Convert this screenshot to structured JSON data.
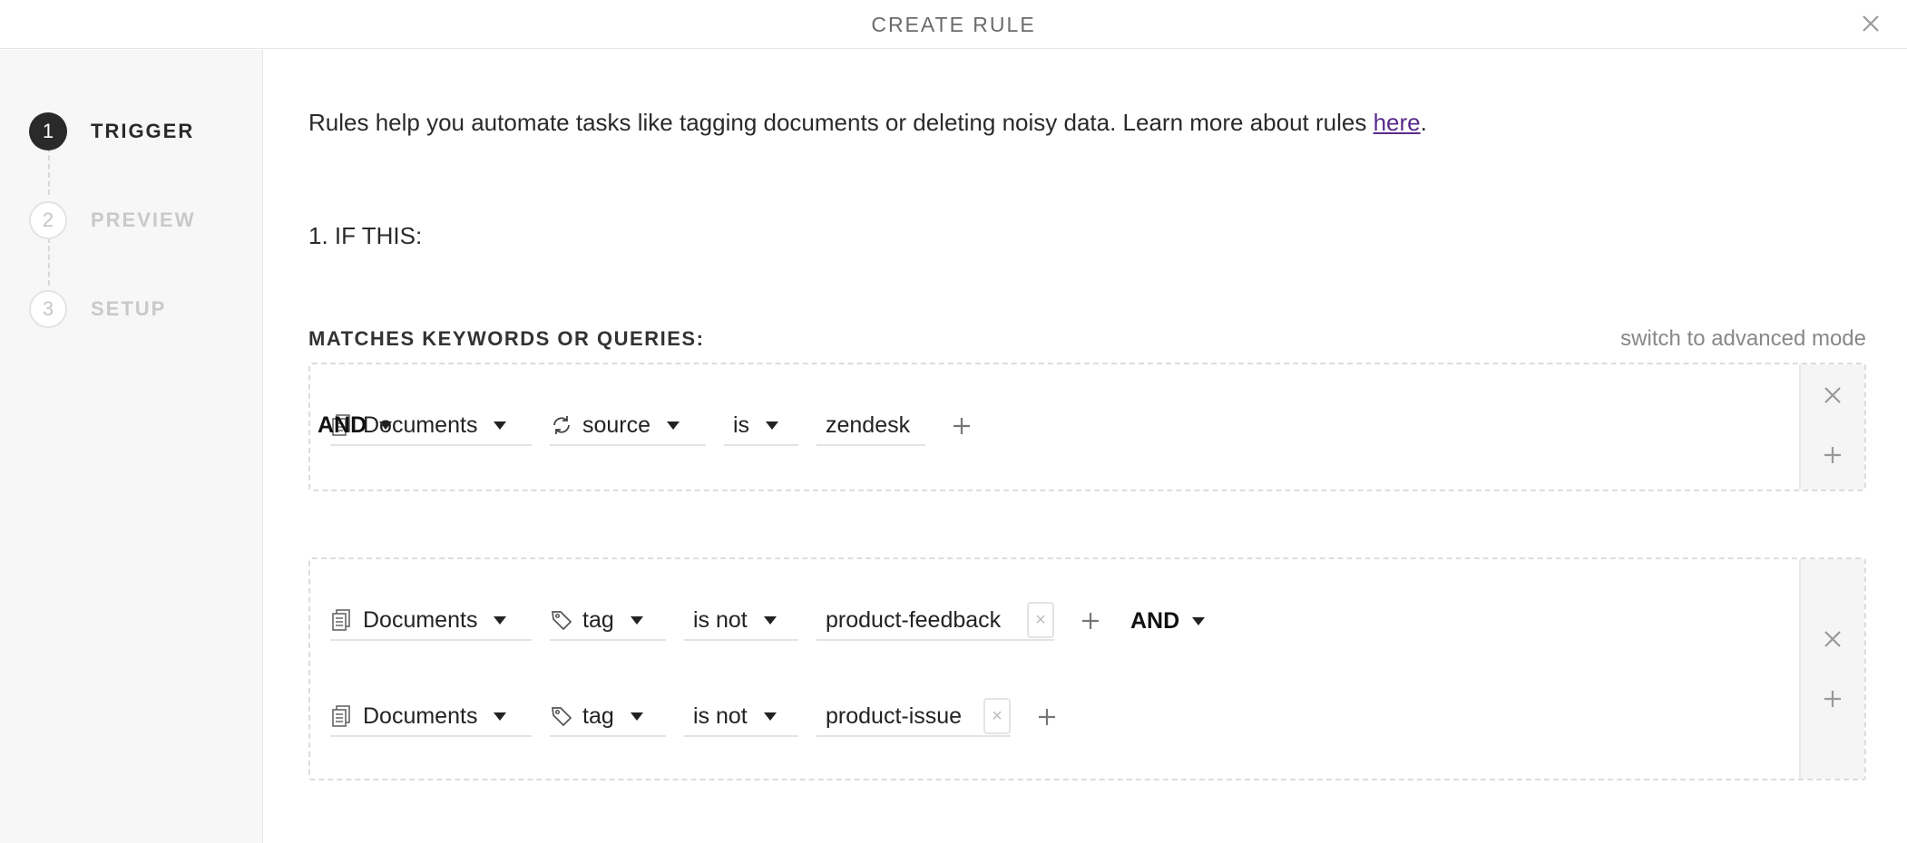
{
  "header": {
    "title": "CREATE RULE"
  },
  "steps": [
    {
      "number": "1",
      "label": "TRIGGER",
      "active": true
    },
    {
      "number": "2",
      "label": "PREVIEW",
      "active": false
    },
    {
      "number": "3",
      "label": "SETUP",
      "active": false
    }
  ],
  "intro": {
    "text": "Rules help you automate tasks like tagging documents or deleting noisy data. Learn more about rules ",
    "link": "here",
    "suffix": "."
  },
  "section": {
    "title": "1. IF THIS:"
  },
  "matches": {
    "label": "MATCHES KEYWORDS OR QUERIES:",
    "advanced_link": "switch to advanced mode"
  },
  "group1": {
    "rows": [
      {
        "entity": "Documents",
        "field": "source",
        "operator": "is",
        "value": "zendesk",
        "field_icon": "source-cycle-icon"
      }
    ]
  },
  "group_join": "AND",
  "group2": {
    "rows": [
      {
        "entity": "Documents",
        "field": "tag",
        "operator": "is not",
        "value": "product-feedback",
        "field_icon": "tag-icon",
        "join": "AND"
      },
      {
        "entity": "Documents",
        "field": "tag",
        "operator": "is not",
        "value": "product-issue",
        "field_icon": "tag-icon"
      }
    ]
  },
  "icons": {
    "close": "close-icon",
    "documents": "documents-icon",
    "plus": "plus-icon",
    "clear": "×"
  },
  "colors": {
    "active_step": "#2a2a2a",
    "link": "#5a2a8a",
    "muted": "#c9c9c9"
  }
}
